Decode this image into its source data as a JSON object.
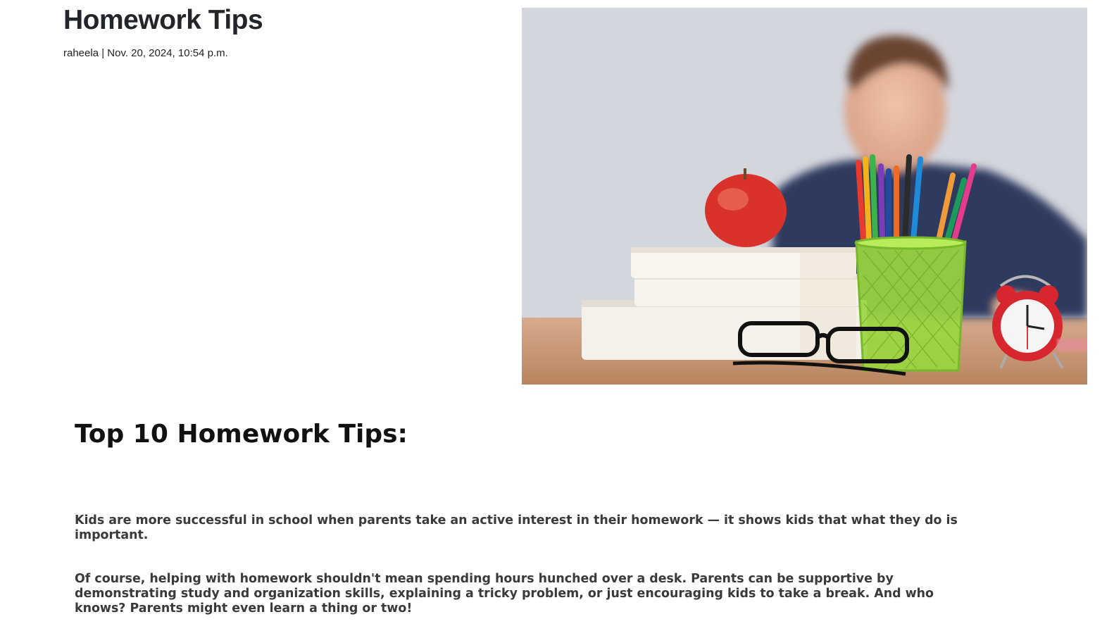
{
  "post": {
    "title": "Homework Tips",
    "meta": "raheela | Nov. 20, 2024, 10:54 p.m."
  },
  "hero_image": {
    "icon": "photo-child-with-books-apple-pencils-clock"
  },
  "article": {
    "heading": "Top 10 Homework Tips:",
    "paragraphs": [
      "Kids are more successful in school when parents take an active interest in their homework — it shows kids that what they do is important.",
      "Of course, helping with homework shouldn't mean spending hours hunched over a desk. Parents can be supportive by demonstrating study and organization skills, explaining a tricky problem, or just encouraging kids to take a break. And who knows? Parents might even learn a thing or two!"
    ]
  }
}
